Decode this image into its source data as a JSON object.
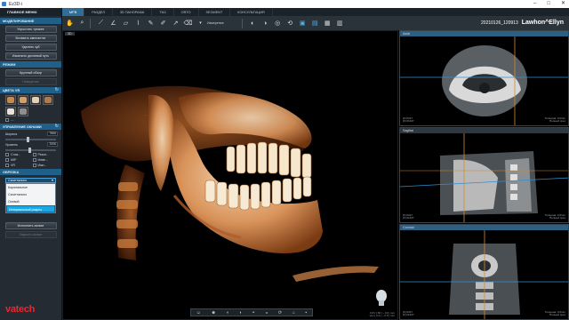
{
  "window": {
    "title": "Ez3D-i"
  },
  "tabs": [
    {
      "label": "МРВ",
      "active": true
    },
    {
      "label": "РАЗДЕЛ",
      "active": false
    },
    {
      "label": "3D ПАНОРАМА",
      "active": false
    },
    {
      "label": "TMJ",
      "active": false
    },
    {
      "label": "ORTO",
      "active": false
    },
    {
      "label": "SEGMENT",
      "active": false
    },
    {
      "label": "КОНСУЛЬТАЦИЯ",
      "active": false
    }
  ],
  "toolbar": {
    "measure_label": "Измерение"
  },
  "patient": {
    "id": "20210126_120913",
    "name": "Lawhon^Ellyn"
  },
  "left_panel": {
    "menu_title": "ГЛАВНОЕ МЕНЮ",
    "section_modeling": "МОДЕЛИРОВАНИЕ",
    "modeling_buttons": [
      "Упростить трекинг",
      "Вставить имплантат",
      "Удалить зуб",
      "Изменить десневой путь"
    ],
    "section_mode": "РЕЖИМ",
    "mode_buttons": [
      "Крупный обзор",
      "Наведение"
    ],
    "section_vr": "ЦВЕТА VR",
    "vr_colors": [
      "#c98a4e",
      "#d4a06a",
      "#e0cfb9",
      "#b07a4f",
      "#e8e3da",
      "#8f8f8f"
    ],
    "section_control": "УПРАВЛЕНИЕ ОКНАМИ",
    "width_label": "Ширина",
    "width_value": "7806",
    "level_label": "Уровень",
    "level_value": "2006",
    "render_options": [
      "Слаз...",
      "Резол...",
      "MIP",
      "Инве...",
      "VR",
      "Имп..."
    ],
    "section_clipping": "ОБРЕЗКА",
    "clipping_select": "Сагиттально",
    "clipping_options": [
      "Корональное",
      "Сагиттально",
      "Осевой",
      "Интервальный разрез"
    ],
    "clipping_selected": "Интервальный разрез",
    "apply_button": "Исполнить захват",
    "cancel_button": "Закрыть захват",
    "logo": "vatech"
  },
  "view3d": {
    "label": "3D",
    "info_line1": "FOV [ 80 ] ~ 90 ] mm",
    "info_line2": "Vox [ 0.2 ] ~ 0.5 ] mm"
  },
  "slices": [
    {
      "name": "Axial",
      "info_left": [
        "[F] 0317",
        "[F] 01327"
      ],
      "info_right": [
        "Толщина: 0.0mm",
        "Полный срез"
      ]
    },
    {
      "name": "Sagittal",
      "info_left": [
        "[F] 0317",
        "[F] 01327"
      ],
      "info_right": [
        "Толщина: 0.0mm",
        "Полный срез"
      ]
    },
    {
      "name": "Coronal",
      "info_left": [
        "[F] 0317",
        "[F] 01327"
      ],
      "info_right": [
        "Толщина: 0.0mm",
        "Полный срез"
      ]
    }
  ],
  "colors": {
    "accent": "#2f6f97",
    "selection": "#19a7e6",
    "bone": "#e4b384",
    "brand": "#e9262f"
  }
}
